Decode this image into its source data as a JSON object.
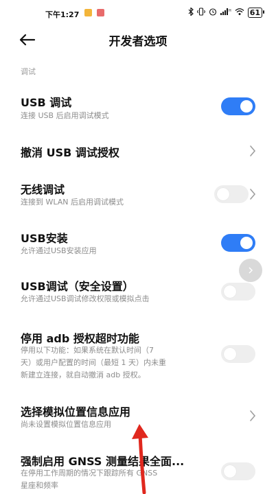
{
  "status_bar": {
    "time": "下午1:27",
    "battery": "61",
    "icons": [
      "bluetooth-icon",
      "vibrate-icon",
      "alarm-icon",
      "signal-icon",
      "wifi-icon",
      "battery-icon"
    ]
  },
  "header": {
    "title": "开发者选项",
    "back_icon": "back-arrow-icon"
  },
  "section": {
    "label": "调试"
  },
  "rows": [
    {
      "title": "USB 调试",
      "desc": "连接 USB 后启用调试模式",
      "control": "toggle",
      "state": "on"
    },
    {
      "title": "撤消 USB 调试授权",
      "control": "chevron"
    },
    {
      "title": "无线调试",
      "desc": "连接到 WLAN 后启用调试模式",
      "control": "toggle+chevron",
      "state": "off"
    },
    {
      "title": "USB安装",
      "desc": "允许通过USB安装应用",
      "control": "toggle",
      "state": "on"
    },
    {
      "title": "USB调试（安全设置）",
      "desc": "允许通过USB调试修改权限或模拟点击",
      "control": "toggle",
      "state": "off"
    },
    {
      "title": "停用 adb 授权超时功能",
      "desc_lines": [
        "停用以下功能：如果系统在默认时间（7",
        "天）或用户配置的时间（最短 1 天）内未重",
        "新建立连接，就自动撤消 adb 授权。"
      ],
      "control": "toggle",
      "state": "off"
    },
    {
      "title": "选择模拟位置信息应用",
      "desc": "尚未设置模拟位置信息应用",
      "control": "chevron"
    },
    {
      "title": "强制启用 GNSS 测量结果全面...",
      "desc_lines": [
        "在停用工作周期的情况下跟踪所有 GNSS",
        "星座和频率"
      ],
      "control": "toggle",
      "state": "off"
    }
  ],
  "colors": {
    "toggle_on": "#2f7df6",
    "toggle_off": "#eeeeee",
    "annotation_arrow": "#e0281e"
  }
}
